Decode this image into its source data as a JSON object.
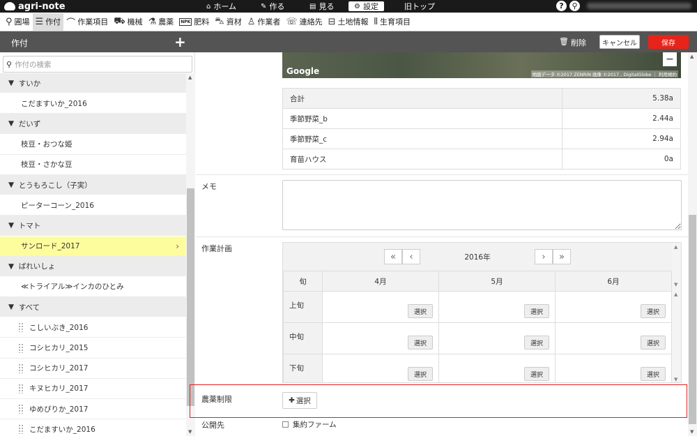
{
  "app": {
    "name": "agri-note"
  },
  "topnav": [
    {
      "label": "ホーム",
      "icon": "home-icon"
    },
    {
      "label": "作る",
      "icon": "pencil-icon"
    },
    {
      "label": "見る",
      "icon": "book-icon"
    },
    {
      "label": "設定",
      "icon": "gear-icon"
    },
    {
      "label": "旧トップ",
      "icon": ""
    }
  ],
  "menu": [
    {
      "label": "圃場",
      "icon": "map-pin-icon"
    },
    {
      "label": "作付",
      "icon": "list-doc-icon"
    },
    {
      "label": "作業項目",
      "icon": "sickle-icon"
    },
    {
      "label": "機械",
      "icon": "tractor-icon"
    },
    {
      "label": "農薬",
      "icon": "flask-icon"
    },
    {
      "label": "肥料",
      "icon": "npk-icon"
    },
    {
      "label": "資材",
      "icon": "wheelbarrow-icon"
    },
    {
      "label": "作業者",
      "icon": "person-icon"
    },
    {
      "label": "連絡先",
      "icon": "contacts-icon"
    },
    {
      "label": "土地情報",
      "icon": "land-icon"
    },
    {
      "label": "生育項目",
      "icon": "growth-icon"
    }
  ],
  "header": {
    "title": "作付",
    "add": "+",
    "delete": "削除",
    "cancel": "キャンセル",
    "save": "保存"
  },
  "sidebar": {
    "search_placeholder": "作付の検索",
    "rows": [
      {
        "type": "group",
        "label": "すいか"
      },
      {
        "type": "item",
        "label": "こだますいか_2016"
      },
      {
        "type": "group",
        "label": "だいず"
      },
      {
        "type": "item",
        "label": "枝豆・おつな姫"
      },
      {
        "type": "item",
        "label": "枝豆・さかな豆"
      },
      {
        "type": "group",
        "label": "とうもろこし（子実）"
      },
      {
        "type": "item",
        "label": "ピーターコーン_2016"
      },
      {
        "type": "group",
        "label": "トマト"
      },
      {
        "type": "selected",
        "label": "サンロード_2017"
      },
      {
        "type": "group",
        "label": "ばれいしょ"
      },
      {
        "type": "item",
        "label": "≪トライアル≫インカのひとみ"
      },
      {
        "type": "group",
        "label": "すべて"
      },
      {
        "type": "drag",
        "label": "こしいぶき_2016"
      },
      {
        "type": "drag",
        "label": "コシヒカリ_2015"
      },
      {
        "type": "drag",
        "label": "コシヒカリ_2017"
      },
      {
        "type": "drag",
        "label": "キヌヒカリ_2017"
      },
      {
        "type": "drag",
        "label": "ゆめぴりか_2017"
      },
      {
        "type": "drag",
        "label": "こだますいか_2016"
      }
    ]
  },
  "map": {
    "logo": "Google",
    "attribution": "地図データ ©2017 ZENRIN 画像 ©2017 , DigitalGlobe ｜ 利用規約",
    "zoom_out": "−"
  },
  "area_table": [
    {
      "name": "合計",
      "value": "5.38a"
    },
    {
      "name": "季節野菜_b",
      "value": "2.44a"
    },
    {
      "name": "季節野菜_c",
      "value": "2.94a"
    },
    {
      "name": "育苗ハウス",
      "value": "0a"
    }
  ],
  "memo": {
    "label": "メモ",
    "value": ""
  },
  "plan": {
    "label": "作業計画",
    "year": "2016年",
    "col0": "旬",
    "months": [
      "4月",
      "5月",
      "6月"
    ],
    "periods": [
      "上旬",
      "中旬",
      "下旬"
    ],
    "select_label": "選択"
  },
  "pesticide_limit": {
    "label": "農薬制限",
    "button": "選択"
  },
  "publish": {
    "label": "公開先",
    "option": "集約ファーム"
  }
}
